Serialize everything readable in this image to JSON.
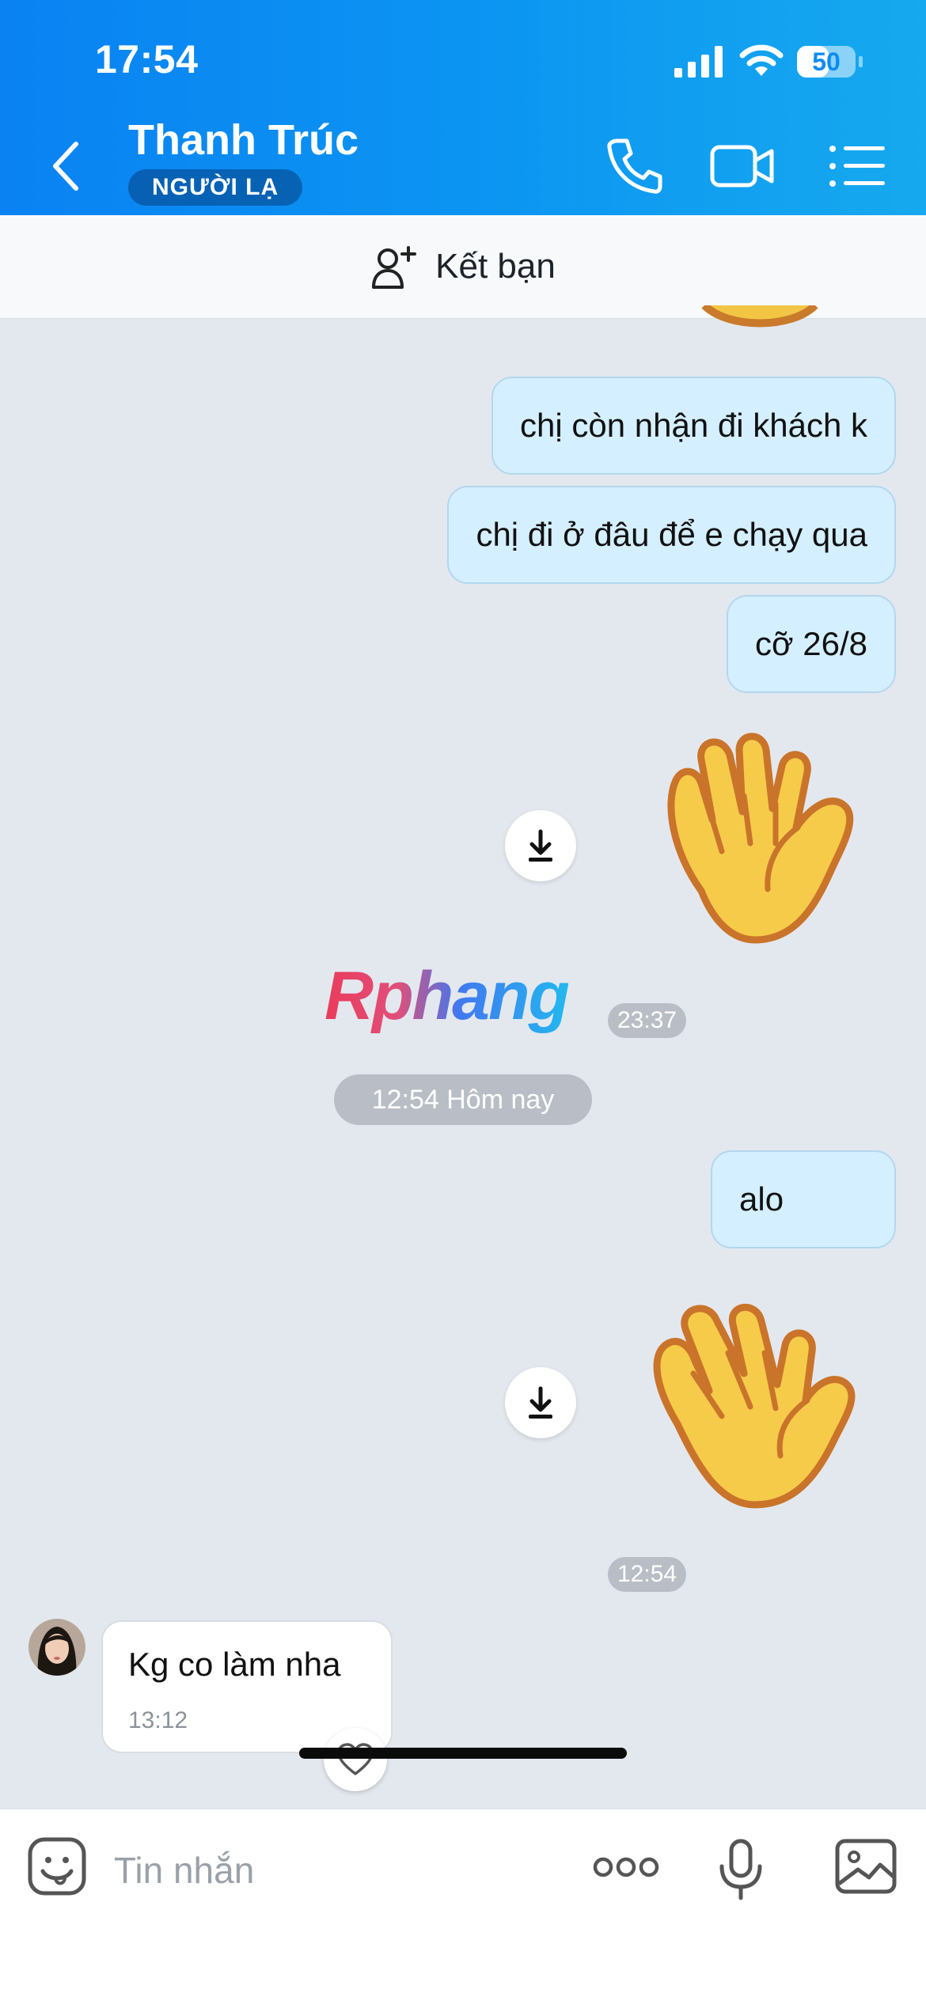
{
  "status_bar": {
    "time": "17:54",
    "battery": "50"
  },
  "header": {
    "contact_name": "Thanh Trúc",
    "badge": "NGƯỜI LẠ"
  },
  "add_friend": {
    "label": "Kết bạn"
  },
  "messages": {
    "out_1": "chị còn nhận đi khách k",
    "out_2": "chị đi ở đâu để e chạy qua",
    "out_3": "cỡ 26/8",
    "sticker_1_time": "23:37",
    "date_separator": "12:54 Hôm nay",
    "out_4": "alo",
    "sticker_2_time": "12:54",
    "incoming_text": "Kg co làm nha",
    "incoming_time": "13:12"
  },
  "watermark": "Rphang",
  "input": {
    "placeholder": "Tin nhắn"
  },
  "colors": {
    "header_start": "#0a82f2",
    "header_end": "#16a9ee",
    "outgoing_bubble": "#d4efff",
    "chat_background": "#e3e8ef"
  }
}
